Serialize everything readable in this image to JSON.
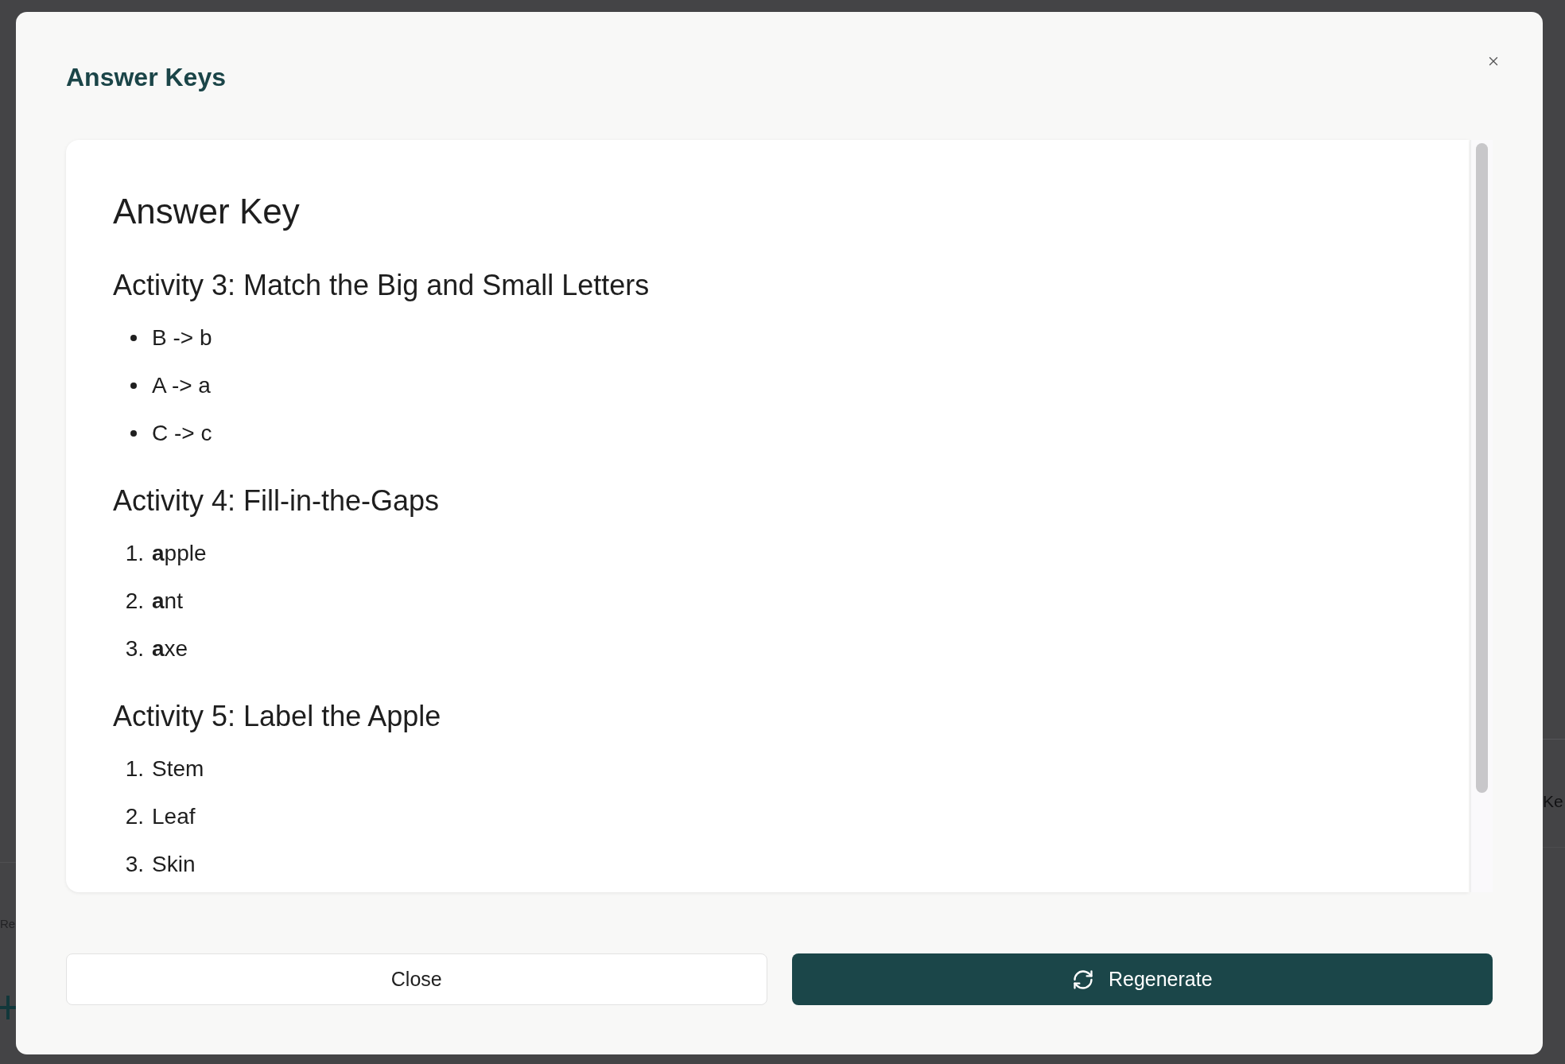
{
  "background_page": {
    "left_text": "Re",
    "right_text": "Ke"
  },
  "dialog": {
    "title": "Answer Keys"
  },
  "answer_key": {
    "heading": "Answer Key",
    "sections": [
      {
        "heading": "Activity 3: Match the Big and Small Letters",
        "kind": "bullet",
        "items": [
          {
            "text": "B -> b"
          },
          {
            "text": "A -> a"
          },
          {
            "text": "C -> c"
          }
        ]
      },
      {
        "heading": "Activity 4: Fill-in-the-Gaps",
        "kind": "numbered",
        "items": [
          {
            "marker": "1.",
            "text": "**a**pple"
          },
          {
            "marker": "2.",
            "text": "**a**nt"
          },
          {
            "marker": "3.",
            "text": "**a**xe"
          }
        ]
      },
      {
        "heading": "Activity 5: Label the Apple",
        "kind": "numbered",
        "items": [
          {
            "marker": "1.",
            "text": "Stem"
          },
          {
            "marker": "2.",
            "text": "Leaf"
          },
          {
            "marker": "3.",
            "text": "Skin"
          }
        ]
      }
    ]
  },
  "buttons": [
    {
      "label": "Close",
      "kind": "secondary"
    },
    {
      "label": "Regenerate",
      "kind": "primary"
    }
  ]
}
